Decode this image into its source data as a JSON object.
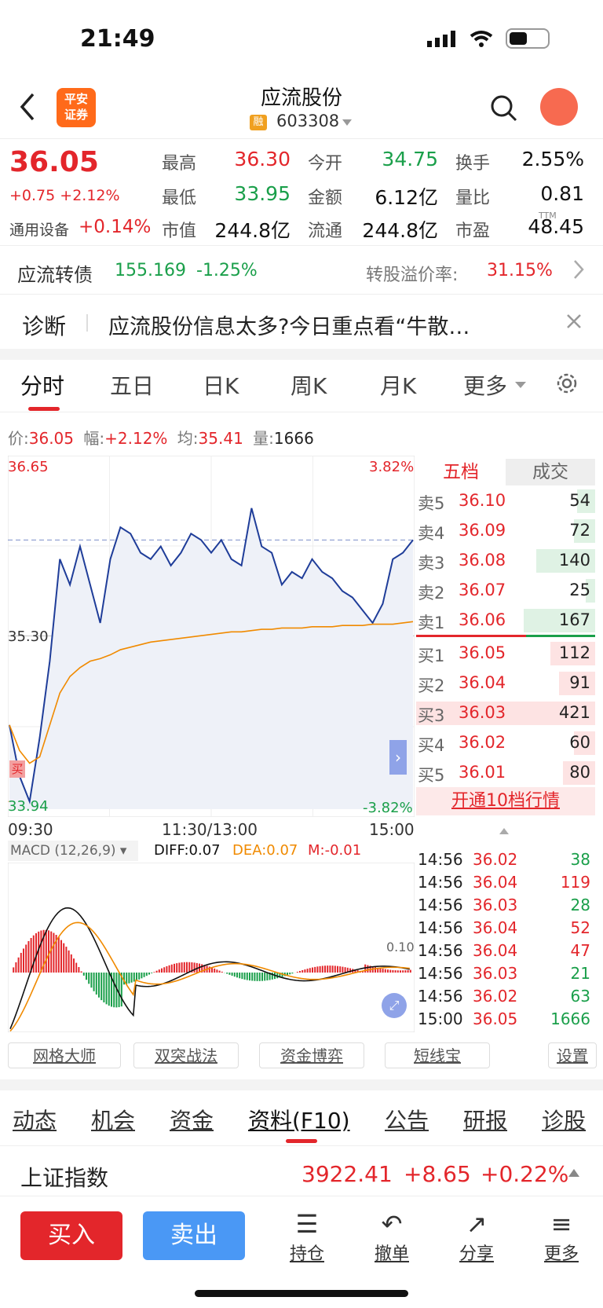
{
  "status": {
    "time": "21:49"
  },
  "header": {
    "broker_logo": "平安\n证券",
    "title": "应流股份",
    "rong": "融",
    "code": "603308"
  },
  "quote": {
    "price": "36.05",
    "change": "+0.75",
    "change_pct": "+2.12%",
    "sector": "通用设备",
    "sector_pct": "+0.14%",
    "cells": [
      {
        "label": "最高",
        "value": "36.30",
        "color": "red"
      },
      {
        "label": "今开",
        "value": "34.75",
        "color": "green"
      },
      {
        "label": "换手",
        "value": "2.55%",
        "color": "black"
      },
      {
        "label": "最低",
        "value": "33.95",
        "color": "green"
      },
      {
        "label": "金额",
        "value": "6.12亿",
        "color": "black"
      },
      {
        "label": "量比",
        "value": "0.81",
        "color": "black"
      },
      {
        "label": "市值",
        "value": "244.8亿",
        "color": "black"
      },
      {
        "label": "流通",
        "value": "244.8亿",
        "color": "black"
      },
      {
        "label": "市盈",
        "value": "48.45",
        "color": "black"
      }
    ],
    "ttm": "TTM"
  },
  "bond": {
    "name": "应流转债",
    "price": "155.169",
    "pct": "-1.25%",
    "premium_label": "转股溢价率:",
    "premium": "31.15%"
  },
  "diagnosis": {
    "label": "诊断",
    "text": "应流股份信息太多?今日重点看“牛散…"
  },
  "tabs": [
    "分时",
    "五日",
    "日K",
    "周K",
    "月K",
    "更多"
  ],
  "chart_info": {
    "price_label": "价:",
    "price": "36.05",
    "amp_label": "幅:",
    "amp": "+2.12%",
    "avg_label": "均:",
    "avg": "35.41",
    "vol_label": "量:",
    "vol": "1666"
  },
  "axis": {
    "top_price": "36.65",
    "top_pct": "3.82%",
    "mid_price": "35.30",
    "bot_price": "33.94",
    "bot_pct": "-3.82%",
    "t_open": "09:30",
    "t_mid": "11:30/13:00",
    "t_close": "15:00"
  },
  "buy_marker": "买",
  "macd": {
    "label": "MACD (12,26,9)",
    "diff": "DIFF:0.07",
    "dea": "DEA:0.07",
    "m": "M:-0.01",
    "level": "0.10"
  },
  "chart_data": {
    "type": "line",
    "x_range": [
      "09:30",
      "15:00"
    ],
    "ylim": [
      33.94,
      36.65
    ],
    "ref_close": 35.3,
    "series": [
      {
        "name": "价",
        "values": [
          34.6,
          34.2,
          34.0,
          34.5,
          35.1,
          35.9,
          35.7,
          36.0,
          35.7,
          35.4,
          35.9,
          36.15,
          36.1,
          35.95,
          35.9,
          36.0,
          35.85,
          35.95,
          36.1,
          36.05,
          35.95,
          36.05,
          35.9,
          35.85,
          36.3,
          36.0,
          35.95,
          35.7,
          35.8,
          35.75,
          35.9,
          35.8,
          35.75,
          35.65,
          35.6,
          35.5,
          35.4,
          35.55,
          35.9,
          35.95,
          36.05
        ]
      },
      {
        "name": "均",
        "values": [
          34.6,
          34.4,
          34.3,
          34.35,
          34.6,
          34.85,
          34.98,
          35.05,
          35.1,
          35.12,
          35.15,
          35.19,
          35.21,
          35.23,
          35.25,
          35.26,
          35.27,
          35.28,
          35.29,
          35.3,
          35.31,
          35.32,
          35.33,
          35.33,
          35.34,
          35.35,
          35.35,
          35.36,
          35.36,
          35.36,
          35.37,
          35.37,
          35.37,
          35.38,
          35.38,
          35.38,
          35.39,
          35.39,
          35.39,
          35.4,
          35.41
        ]
      }
    ]
  },
  "orderbook": {
    "tabs": [
      "五档",
      "成交"
    ],
    "rows": [
      {
        "label": "卖5",
        "price": "36.10",
        "vol": "54",
        "bar": 0.1
      },
      {
        "label": "卖4",
        "price": "36.09",
        "vol": "72",
        "bar": 0.12
      },
      {
        "label": "卖3",
        "price": "36.08",
        "vol": "140",
        "bar": 0.33
      },
      {
        "label": "卖2",
        "price": "36.07",
        "vol": "25",
        "bar": 0.05
      },
      {
        "label": "卖1",
        "price": "36.06",
        "vol": "167",
        "bar": 0.4
      },
      {
        "label": "买1",
        "price": "36.05",
        "vol": "112",
        "bar": 0.25
      },
      {
        "label": "买2",
        "price": "36.04",
        "vol": "91",
        "bar": 0.2
      },
      {
        "label": "买3",
        "price": "36.03",
        "vol": "421",
        "bar": 1.0
      },
      {
        "label": "买4",
        "price": "36.02",
        "vol": "60",
        "bar": 0.12
      },
      {
        "label": "买5",
        "price": "36.01",
        "vol": "80",
        "bar": 0.18
      }
    ],
    "open_ten": "开通10档行情"
  },
  "ticks": [
    {
      "time": "14:56",
      "price": "36.02",
      "vol": "38",
      "c": "green"
    },
    {
      "time": "14:56",
      "price": "36.04",
      "vol": "119",
      "c": "red"
    },
    {
      "time": "14:56",
      "price": "36.03",
      "vol": "28",
      "c": "green"
    },
    {
      "time": "14:56",
      "price": "36.04",
      "vol": "52",
      "c": "red"
    },
    {
      "time": "14:56",
      "price": "36.04",
      "vol": "47",
      "c": "red"
    },
    {
      "time": "14:56",
      "price": "36.03",
      "vol": "21",
      "c": "green"
    },
    {
      "time": "14:56",
      "price": "36.02",
      "vol": "63",
      "c": "green"
    },
    {
      "time": "15:00",
      "price": "36.05",
      "vol": "1666",
      "c": "green"
    }
  ],
  "tools": [
    "网格大师",
    "双突战法",
    "资金博弈",
    "短线宝",
    "设置"
  ],
  "f10_tabs": [
    "动态",
    "机会",
    "资金",
    "资料(F10)",
    "公告",
    "研报",
    "诊股"
  ],
  "index": {
    "name": "上证指数",
    "value": "3922.41",
    "change": "+8.65",
    "pct": "+0.22%"
  },
  "bottom": {
    "buy": "买入",
    "sell": "卖出",
    "nav": [
      {
        "label": "持仓",
        "icon": "☰"
      },
      {
        "label": "撤单",
        "icon": "↶"
      },
      {
        "label": "分享",
        "icon": "↗"
      },
      {
        "label": "更多",
        "icon": "≡"
      }
    ]
  },
  "colors": {
    "red": "#e3262b",
    "green": "#1a9f4a",
    "blue": "#1f3d99",
    "orange": "#f08a00"
  }
}
